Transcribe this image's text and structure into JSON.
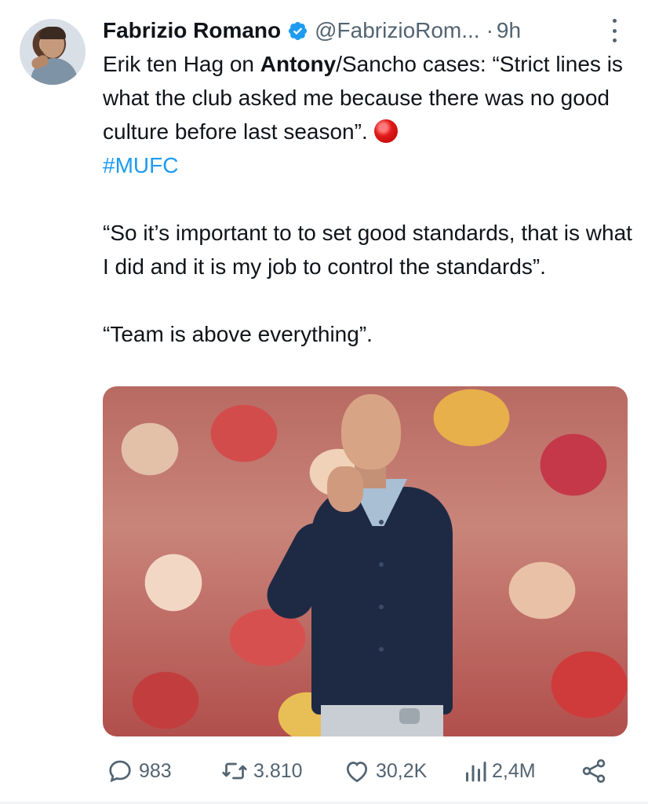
{
  "author": {
    "name": "Fabrizio Romano",
    "handle": "@FabrizioRom...",
    "separator": "·",
    "time": "9h"
  },
  "tweet": {
    "line1_prefix": "Erik ten Hag on ",
    "line1_bold": "Antony",
    "line1_suffix": "/Sancho cases: “Strict lines is what the club asked me because there was no good culture before last season”.",
    "hashtag": "#MUFC",
    "paragraph2": "“So it’s important to to set good standards, that is what I did and it is my job to control the standards”.",
    "paragraph3": "“Team is above everything”."
  },
  "actions": {
    "replies": "983",
    "retweets": "3.810",
    "likes": "30,2K",
    "views": "2,4M"
  },
  "colors": {
    "text": "#0f1419",
    "secondary": "#536471",
    "link": "#1d9bf0",
    "verified": "#1d9bf0"
  },
  "icons": [
    "verified-badge-icon",
    "more-options-icon",
    "red-circle-emoji",
    "reply-icon",
    "retweet-icon",
    "like-icon",
    "views-icon",
    "share-icon"
  ]
}
